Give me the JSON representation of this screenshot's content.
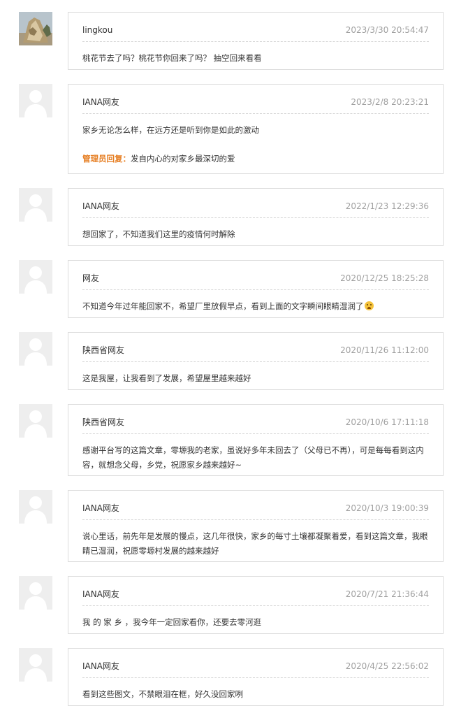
{
  "comments": [
    {
      "user": "lingkou",
      "time": "2023/3/30 20:54:47",
      "text": "桃花节去了吗？桃花节你回来了吗？ 抽空回来看看",
      "avatar": "photo-avatar"
    },
    {
      "user": "IANA网友",
      "time": "2023/2/8 20:23:21",
      "text": "家乡无论怎么样，在远方还是听到你是如此的激动",
      "reply_label": "管理员回复：",
      "reply_text": "发自内心的对家乡最深切的爱",
      "avatar": "default-avatar"
    },
    {
      "user": "IANA网友",
      "time": "2022/1/23 12:29:36",
      "text": "想回家了，不知道我们这里的疫情何时解除",
      "avatar": "default-avatar"
    },
    {
      "user": "网友",
      "time": "2020/12/25 18:25:28",
      "text": "不知道今年过年能回家不，希望厂里放假早点，看到上面的文字瞬间眼睛湿润了",
      "emoji": "crying-face-emoji",
      "avatar": "default-avatar"
    },
    {
      "user": "陕西省网友",
      "time": "2020/11/26 11:12:00",
      "text": "这是我屋，让我看到了发展，希望屋里越来越好",
      "avatar": "default-avatar"
    },
    {
      "user": "陕西省网友",
      "time": "2020/10/6 17:11:18",
      "text": "感谢平台写的这篇文章，零塬我的老家，虽说好多年未回去了（父母已不再），可是每每看到这内容，就想念父母，乡党，祝愿家乡越来越好~",
      "avatar": "default-avatar"
    },
    {
      "user": "IANA网友",
      "time": "2020/10/3 19:00:39",
      "text": "说心里话，前先年是发展的慢点，这几年很快，家乡的每寸土壤都凝聚着爱，看到这篇文章，我眼睛已湿润，祝愿零塬村发展的越来越好",
      "avatar": "default-avatar"
    },
    {
      "user": "IANA网友",
      "time": "2020/7/21 21:36:44",
      "text": "我 的 家 乡 ，我今年一定回家看你，还要去零河逛",
      "avatar": "default-avatar"
    },
    {
      "user": "IANA网友",
      "time": "2020/4/25 22:56:02",
      "text": "看到这些图文，不禁眼泪在框，好久没回家咧",
      "avatar": "default-avatar"
    }
  ],
  "colors": {
    "border": "#dcdcdc",
    "divider": "#d6d6d6",
    "time": "#a0a0a0",
    "text": "#333333",
    "admin_reply": "#e67e22",
    "avatar_bg": "#eeeeee"
  }
}
